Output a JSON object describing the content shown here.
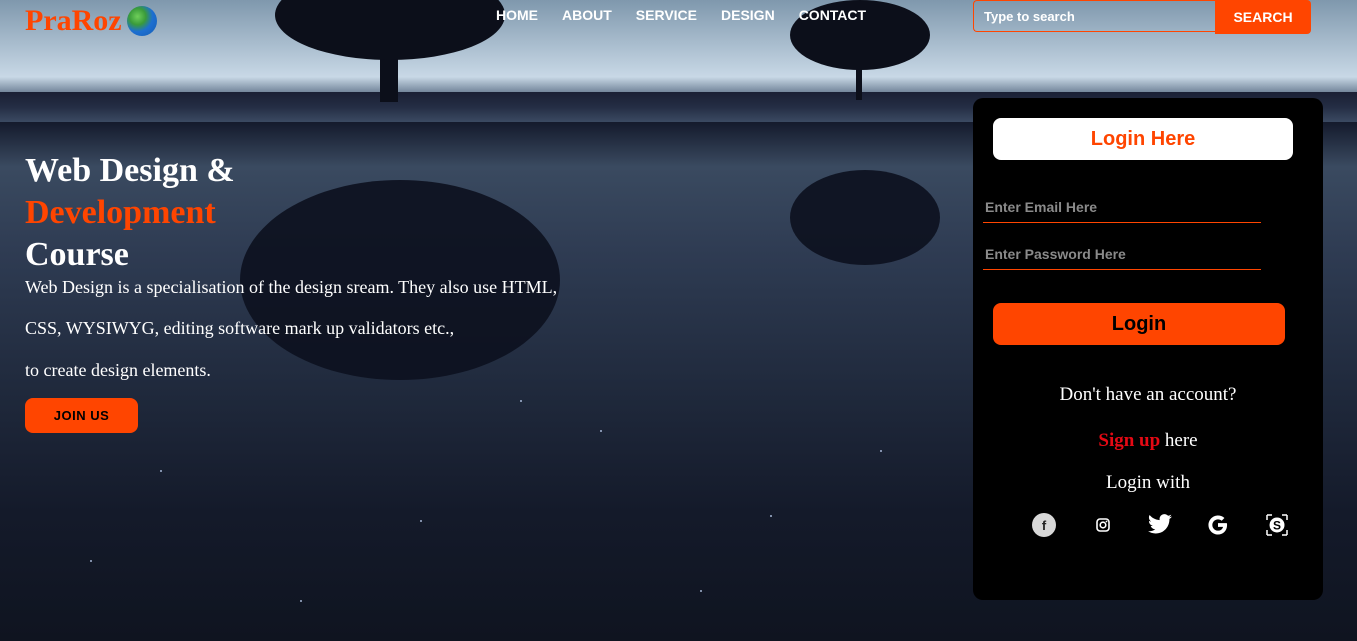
{
  "brand": {
    "name": "PraRoz",
    "logo_icon": "globe-icon"
  },
  "nav": [
    {
      "label": "HOME"
    },
    {
      "label": "ABOUT"
    },
    {
      "label": "SERVICE"
    },
    {
      "label": "DESIGN"
    },
    {
      "label": "CONTACT"
    }
  ],
  "search": {
    "placeholder": "Type to search",
    "button_label": "SEARCH"
  },
  "hero": {
    "title_line1": "Web Design &",
    "title_line2": "Development",
    "title_line3": "Course",
    "para_line1": "Web Design is a specialisation of the design sream. They also use HTML,",
    "para_line2": "CSS, WYSIWYG, editing software mark up validators etc.,",
    "para_line3": "to create design elements.",
    "cta_label": "JOIN US"
  },
  "login": {
    "title": "Login Here",
    "email_placeholder": "Enter Email Here",
    "password_placeholder": "Enter Password Here",
    "button_label": "Login",
    "no_account": "Don't have an account?",
    "signup_link": "Sign up",
    "signup_suffix": "here",
    "login_with": "Login with",
    "social": [
      "facebook-icon",
      "instagram-icon",
      "twitter-icon",
      "google-icon",
      "skype-icon"
    ]
  },
  "colors": {
    "accent": "#ff4500",
    "card_bg": "#000000",
    "signup": "#e50914"
  }
}
